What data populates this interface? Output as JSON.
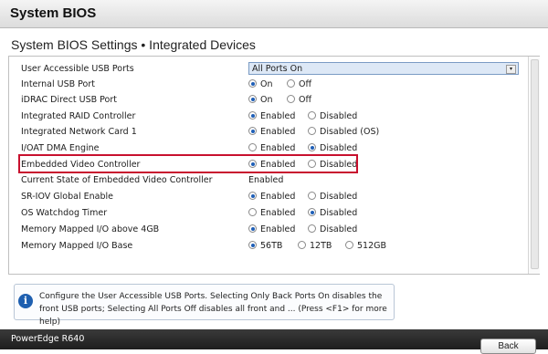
{
  "window": {
    "title": "System BIOS"
  },
  "page": {
    "subtitle": "System BIOS Settings • Integrated Devices"
  },
  "settings": {
    "usb_ports": {
      "label": "User Accessible USB Ports",
      "value": "All Ports On"
    },
    "internal_usb": {
      "label": "Internal USB Port",
      "on": "On",
      "off": "Off",
      "selected": "On"
    },
    "idrac_usb": {
      "label": "iDRAC Direct USB Port",
      "on": "On",
      "off": "Off",
      "selected": "On"
    },
    "raid": {
      "label": "Integrated RAID Controller",
      "enabled": "Enabled",
      "disabled": "Disabled",
      "selected": "Enabled"
    },
    "nic": {
      "label": "Integrated Network Card 1",
      "enabled": "Enabled",
      "disabled": "Disabled (OS)",
      "selected": "Enabled"
    },
    "ioat": {
      "label": "I/OAT DMA Engine",
      "enabled": "Enabled",
      "disabled": "Disabled",
      "selected": "Disabled"
    },
    "video": {
      "label": "Embedded Video Controller",
      "enabled": "Enabled",
      "disabled": "Disabled",
      "selected": "Enabled"
    },
    "video_state": {
      "label": "Current State of Embedded Video Controller",
      "value": "Enabled"
    },
    "sriov": {
      "label": "SR-IOV Global Enable",
      "enabled": "Enabled",
      "disabled": "Disabled",
      "selected": "Enabled"
    },
    "watchdog": {
      "label": "OS Watchdog Timer",
      "enabled": "Enabled",
      "disabled": "Disabled",
      "selected": "Disabled"
    },
    "mmio4g": {
      "label": "Memory Mapped I/O above 4GB",
      "enabled": "Enabled",
      "disabled": "Disabled",
      "selected": "Enabled"
    },
    "mmio_base": {
      "label": "Memory Mapped I/O Base",
      "opt1": "56TB",
      "opt2": "12TB",
      "opt3": "512GB",
      "selected": "56TB"
    }
  },
  "help": {
    "icon": "info-icon",
    "text": "Configure the User Accessible USB Ports. Selecting Only Back Ports On disables the front USB ports; Selecting All Ports Off disables all front and ... (Press <F1> for more help)"
  },
  "footer": {
    "model": "PowerEdge R640"
  },
  "buttons": {
    "back": "Back"
  },
  "colors": {
    "highlight": "#c8102e",
    "radio_selected": "#1f5fb7",
    "info_icon": "#1e5fb0"
  }
}
